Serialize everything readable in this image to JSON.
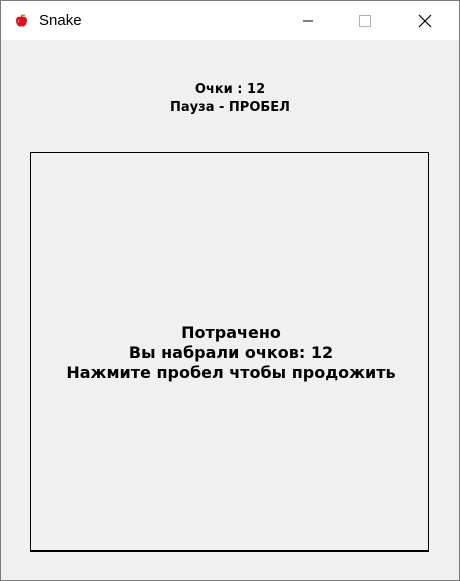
{
  "window": {
    "title": "Snake",
    "icon": "apple-icon"
  },
  "score": {
    "label": "Очки : 12",
    "pause_hint": "Пауза - ПРОБЕЛ"
  },
  "game_over": {
    "title": "Потрачено",
    "score_line": "Вы набрали очков: 12",
    "restart_hint": "Нажмите пробел чтобы продожить"
  },
  "colors": {
    "apple": "#d9141c",
    "background": "#f0f0f0",
    "border": "#000000"
  }
}
